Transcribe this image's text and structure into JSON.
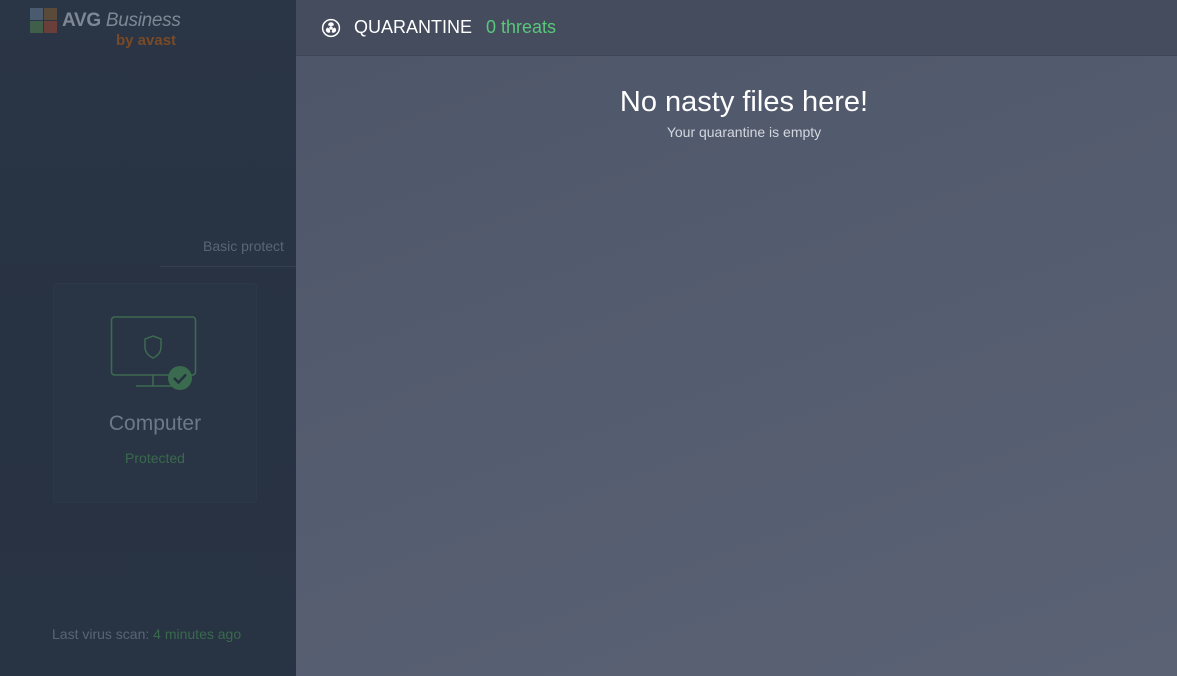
{
  "app": {
    "brand_title": "AVG",
    "brand_title_suffix": "Business",
    "brand_sub": "by avast"
  },
  "dashboard": {
    "section_label": "Basic protect",
    "card": {
      "title": "Computer",
      "status": "Protected",
      "icon": "monitor-shield-icon"
    },
    "last_scan_label": "Last virus scan:",
    "last_scan_value": "4 minutes ago"
  },
  "quarantine": {
    "icon": "biohazard-icon",
    "title": "QUARANTINE",
    "count": "0 threats",
    "empty_title": "No nasty files here!",
    "empty_subtitle": "Your quarantine is empty"
  },
  "colors": {
    "accent_green": "#59c879",
    "panel_bg": "#535b6e",
    "header_bg": "#444c5d",
    "dim_bg": "#263140"
  }
}
